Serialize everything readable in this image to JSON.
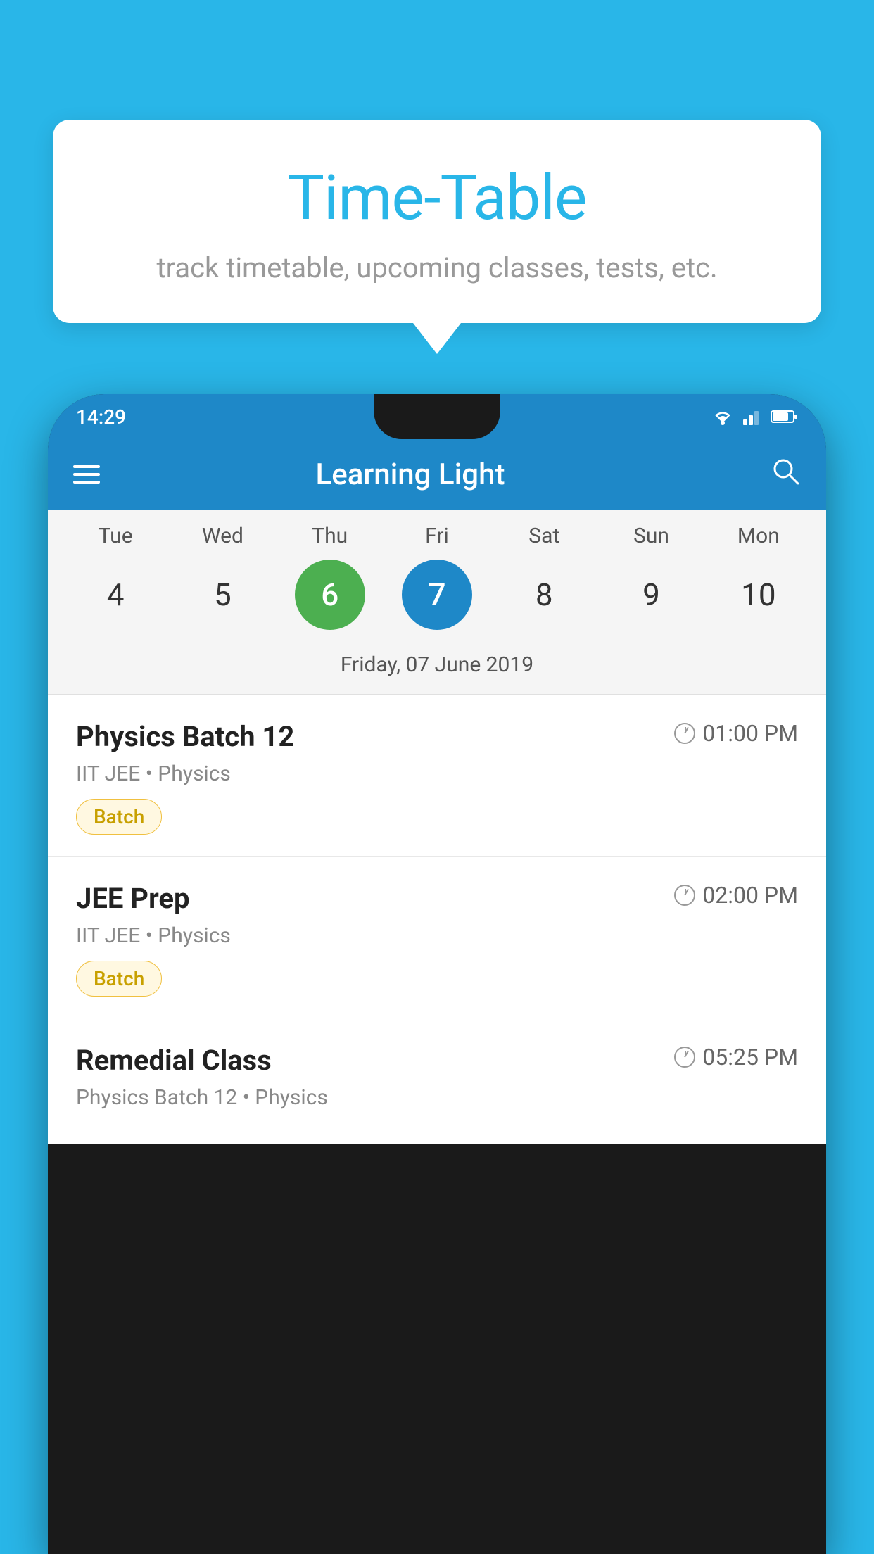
{
  "background_color": "#29b6e8",
  "tooltip": {
    "title": "Time-Table",
    "subtitle": "track timetable, upcoming classes, tests, etc."
  },
  "phone": {
    "status_bar": {
      "time": "14:29"
    },
    "app_bar": {
      "title": "Learning Light"
    },
    "calendar": {
      "days": [
        "Tue",
        "Wed",
        "Thu",
        "Fri",
        "Sat",
        "Sun",
        "Mon"
      ],
      "dates": [
        "4",
        "5",
        "6",
        "7",
        "8",
        "9",
        "10"
      ],
      "today_index": 2,
      "selected_index": 3,
      "selected_date_label": "Friday, 07 June 2019"
    },
    "classes": [
      {
        "name": "Physics Batch 12",
        "time": "01:00 PM",
        "meta": "IIT JEE • Physics",
        "badge": "Batch"
      },
      {
        "name": "JEE Prep",
        "time": "02:00 PM",
        "meta": "IIT JEE • Physics",
        "badge": "Batch"
      },
      {
        "name": "Remedial Class",
        "time": "05:25 PM",
        "meta": "Physics Batch 12 • Physics",
        "badge": null
      }
    ]
  }
}
